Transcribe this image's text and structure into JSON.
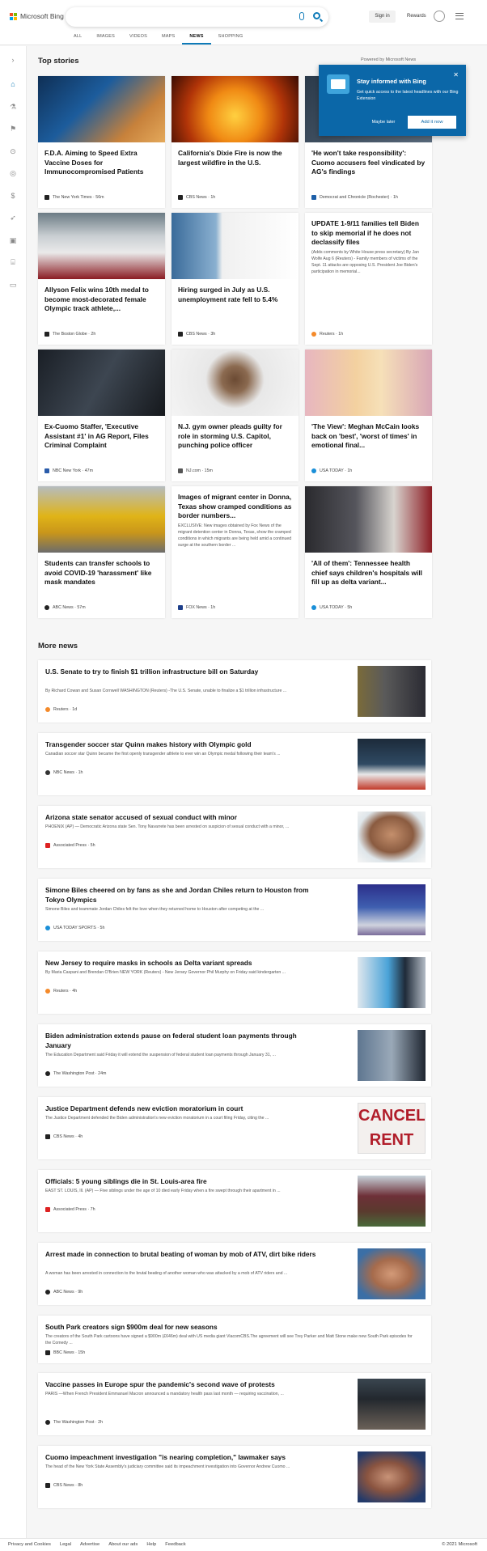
{
  "header": {
    "brand": "Microsoft Bing",
    "signin": "Sign in",
    "rewards": "Rewards"
  },
  "tabs": [
    "ALL",
    "IMAGES",
    "VIDEOS",
    "MAPS",
    "NEWS",
    "SHOPPING"
  ],
  "top_stories": {
    "title": "Top stories",
    "powered": "Powered by Microsoft News",
    "cards": [
      {
        "title": "F.D.A. Aiming to Speed Extra Vaccine Doses for Immunocompromised Patients",
        "source": "The New York Times · 56m",
        "icon_color": "#222"
      },
      {
        "title": "California's Dixie Fire is now the largest wildfire in the U.S.",
        "source": "CBS News · 1h",
        "icon_color": "#222"
      },
      {
        "title": "'He won't take responsibility': Cuomo accusers feel vindicated by AG's findings",
        "source": "Democrat and Chronicle (Rochester) · 1h",
        "icon_color": "#1d5fa8"
      },
      {
        "title": "Allyson Felix wins 10th medal to become most-decorated female Olympic track athlete,...",
        "source": "The Boston Globe · 2h",
        "icon_color": "#222"
      },
      {
        "title": "Hiring surged in July as U.S. unemployment rate fell to 5.4%",
        "source": "CBS News · 3h",
        "icon_color": "#222"
      },
      {
        "title": "UPDATE 1-9/11 families tell Biden to skip memorial if he does not declassify files",
        "description": "(Adds comments by White House press secretary) By Jan Wolfe Aug 6 (Reuters) - Family members of victims of the Sept. 11 attacks are opposing U.S. President Joe Biden's participation in memorial...",
        "source": "Reuters · 1h",
        "icon_color": "#f48a2a"
      },
      {
        "title": "Ex-Cuomo Staffer, 'Executive Assistant #1' in AG Report, Files Criminal Complaint",
        "source": "NBC New York · 47m",
        "icon_color": "#2a5caa"
      },
      {
        "title": "N.J. gym owner pleads guilty for role in storming U.S. Capitol, punching police officer",
        "source": "NJ.com · 15m",
        "icon_color": "#555"
      },
      {
        "title": "'The View': Meghan McCain looks back on 'best', 'worst of times' in emotional final...",
        "source": "USA TODAY · 1h",
        "icon_color": "#1a8fd8"
      },
      {
        "title": "Students can transfer schools to avoid COVID-19 'harassment' like mask mandates",
        "source": "ABC News · 57m",
        "icon_color": "#222"
      },
      {
        "title": "Images of migrant center in Donna, Texas show cramped conditions as border numbers...",
        "description": "EXCLUSIVE: New images obtained by Fox News of the migrant detention center in Donna, Texas, show the cramped conditions in which migrants are being held amid a continued surge at the southern border ...",
        "source": "FOX News · 1h",
        "icon_color": "#1d3f8a"
      },
      {
        "title": "'All of them': Tennessee health chief says children's hospitals will fill up as delta variant...",
        "source": "USA TODAY · 5h",
        "icon_color": "#1a8fd8"
      }
    ]
  },
  "popup": {
    "title": "Stay informed with Bing",
    "text": "Get quick access to the latest headlines with our Bing Extension",
    "later": "Maybe later",
    "add": "Add it now"
  },
  "more_news": {
    "title": "More news",
    "items": [
      {
        "title": "U.S. Senate to try to finish $1 trillion infrastructure bill on Saturday",
        "description": "By Richard Cowan and Susan Cornwell WASHINGTON (Reuters) -The U.S. Senate, unable to finalize a $1 trillion infrastructure ...",
        "source": "Reuters · 1d",
        "icon_color": "#f48a2a"
      },
      {
        "title": "Transgender soccer star Quinn makes history with Olympic gold",
        "description": "Canadian soccer star Quinn became the first openly transgender athlete to ever win an Olympic medal following their team's ...",
        "source": "NBC News · 1h",
        "icon_color": "#333"
      },
      {
        "title": "Arizona state senator accused of sexual conduct with minor",
        "description": "PHOENIX (AP) — Democratic Arizona state Sen. Tony Navarrete has been arrested on suspicion of sexual conduct with a minor, ...",
        "source": "Associated Press · 5h",
        "icon_color": "#d22"
      },
      {
        "title": "Simone Biles cheered on by fans as she and Jordan Chiles return to Houston from Tokyo Olympics",
        "description": "Simone Biles and teammate Jordan Chiles felt the love when they returned home to Houston after competing at the ...",
        "source": "USA TODAY SPORTS · 5h",
        "icon_color": "#1a8fd8"
      },
      {
        "title": "New Jersey to require masks in schools as Delta variant spreads",
        "description": "By Maria Caspani and Brendan O'Brien NEW YORK (Reuters) - New Jersey Governor Phil Murphy on Friday said kindergarten ...",
        "source": "Reuters · 4h",
        "icon_color": "#f48a2a"
      },
      {
        "title": "Biden administration extends pause on federal student loan payments through January",
        "description": "The Education Department said Friday it will extend the suspension of federal student loan payments through January 31, ...",
        "source": "The Washington Post · 24m",
        "icon_color": "#222"
      },
      {
        "title": "Justice Department defends new eviction moratorium in court",
        "description": "The Justice Department defended the Biden administration's new eviction moratorium in a court filing Friday, citing the ...",
        "source": "CBS News · 4h",
        "icon_color": "#222"
      },
      {
        "title": "Officials: 5 young siblings die in St. Louis-area fire",
        "description": "EAST ST. LOUIS, Ill. (AP) — Five siblings under the age of 10 died early Friday when a fire swept through their apartment in ...",
        "source": "Associated Press · 7h",
        "icon_color": "#d22"
      },
      {
        "title": "Arrest made in connection to brutal beating of woman by mob of ATV, dirt bike riders",
        "description": "A woman has been arrested in connection to the brutal beating of another woman who was attacked by a mob of ATV riders and ...",
        "source": "ABC News · 9h",
        "icon_color": "#222"
      },
      {
        "title": "South Park creators sign $900m deal for new seasons",
        "description": "The creators of the South Park cartoons have signed a $900m (£646m) deal with US media giant ViacomCBS.The agreement will see Trey Parker and Matt Stone make new South Park episodes for the Comedy ...",
        "source": "BBC News · 15h",
        "icon_color": "#222"
      },
      {
        "title": "Vaccine passes in Europe spur the pandemic's second wave of protests",
        "description": "PARIS —When French President Emmanuel Macron announced a mandatory health pass last month — requiring vaccination, ...",
        "source": "The Washington Post · 2h",
        "icon_color": "#222"
      },
      {
        "title": "Cuomo impeachment investigation \"is nearing completion,\" lawmaker says",
        "description": "The head of the New York State Assembly's judiciary committee said its impeachment investigation into Governor Andrew Cuomo ...",
        "source": "CBS News · 8h",
        "icon_color": "#222"
      }
    ]
  },
  "footer": {
    "links": [
      "Privacy and Cookies",
      "Legal",
      "Advertise",
      "About our ads",
      "Help",
      "Feedback"
    ],
    "copyright": "© 2021 Microsoft"
  }
}
